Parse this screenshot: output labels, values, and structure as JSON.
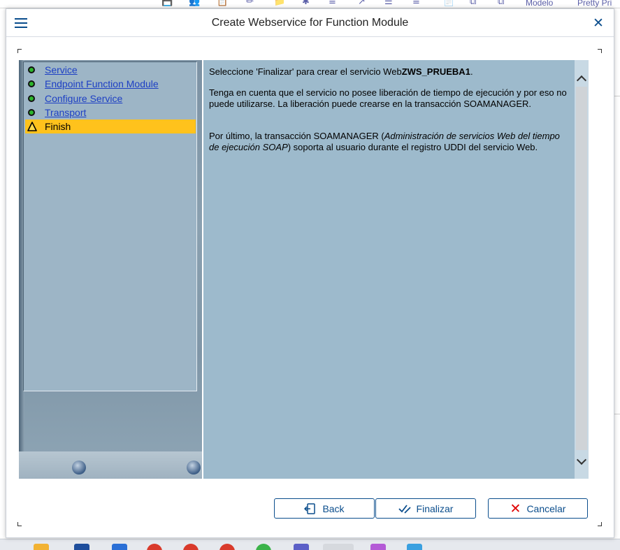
{
  "dialog": {
    "title": "Create Webservice for Function Module"
  },
  "steps": [
    {
      "label": "Service",
      "status": "done"
    },
    {
      "label": "Endpoint Function Module",
      "status": "done"
    },
    {
      "label": "Configure Service",
      "status": "done"
    },
    {
      "label": "Transport",
      "status": "done"
    },
    {
      "label": "Finish",
      "status": "current"
    }
  ],
  "content": {
    "p1_text": "Seleccione 'Finalizar' para crear el servicio Web",
    "p1_service": "ZWS_PRUEBA1",
    "p1_end": ".",
    "p2": "Tenga en cuenta que el servicio no posee liberación de tiempo de ejecución y por eso no puede utilizarse. La liberación puede crearse en la transacción SOAMANAGER.",
    "p3_start": "Por último, la transacción SOAMANAGER (",
    "p3_italic": "Administración de servicios Web del tiempo de ejecución SOAP",
    "p3_end": ") soporta al usuario durante el registro UDDI del servicio Web."
  },
  "buttons": {
    "back": "Back",
    "finish": "Finalizar",
    "cancel": "Cancelar"
  },
  "background": {
    "toolbar_text_1": "Modelo",
    "toolbar_text_2": "Pretty Pri",
    "toolbar_glyphs": [
      "💾",
      "👥",
      "📋",
      "✏",
      "📁",
      "✱",
      "≡",
      "↗",
      "☰",
      "≡",
      "📄",
      "⧉",
      "⧉"
    ]
  },
  "colors": {
    "accent": "#0a4d8c",
    "status_done": "#2bb52b",
    "current_step": "#ffc21c",
    "cancel_icon": "#e00000",
    "link": "#1d3fc4"
  }
}
